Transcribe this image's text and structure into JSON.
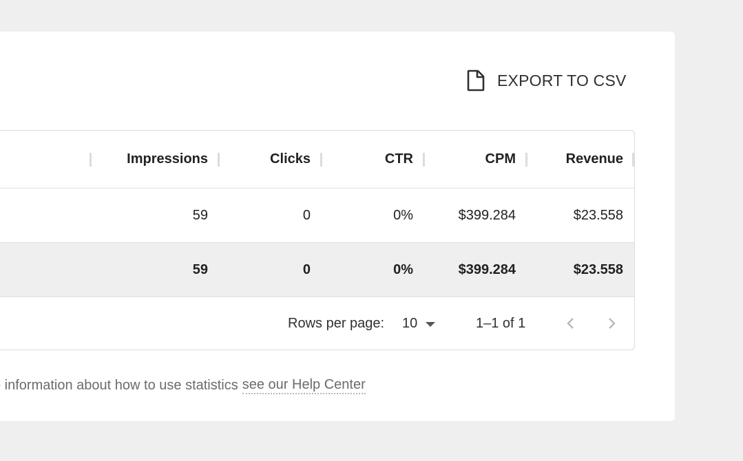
{
  "export": {
    "label": "EXPORT TO CSV",
    "icon": "file-icon"
  },
  "table": {
    "columns": [
      "Impressions",
      "Clicks",
      "CTR",
      "CPM",
      "Revenue"
    ],
    "rows": [
      {
        "impressions": "59",
        "clicks": "0",
        "ctr": "0%",
        "cpm": "$399.284",
        "revenue": "$23.558"
      }
    ],
    "totals": {
      "impressions": "59",
      "clicks": "0",
      "ctr": "0%",
      "cpm": "$399.284",
      "revenue": "$23.558"
    }
  },
  "pagination": {
    "rows_per_page_label": "Rows per page:",
    "rows_per_page_value": "10",
    "range_label": "1–1 of 1"
  },
  "help": {
    "text": "e information about how to use statistics",
    "link_text": "see our Help Center"
  },
  "colors": {
    "page_bg": "#efefef",
    "card_bg": "#ffffff",
    "total_row_bg": "#efefef",
    "text": "#212121",
    "muted_text": "#6b6b6b"
  }
}
